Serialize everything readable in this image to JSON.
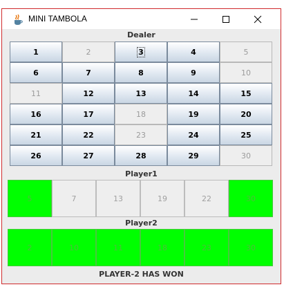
{
  "window": {
    "title": "MINI TAMBOLA",
    "controls": [
      "minimize",
      "maximize",
      "close"
    ],
    "icons": {
      "app": "java-cup-icon",
      "minimize": "minimize-icon",
      "maximize": "maximize-icon",
      "close": "close-icon"
    }
  },
  "dealer": {
    "label": "Dealer",
    "numbers": [
      {
        "value": "1",
        "called": false,
        "focused": false
      },
      {
        "value": "2",
        "called": true,
        "focused": false
      },
      {
        "value": "3",
        "called": false,
        "focused": true
      },
      {
        "value": "4",
        "called": false,
        "focused": false
      },
      {
        "value": "5",
        "called": true,
        "focused": false
      },
      {
        "value": "6",
        "called": false,
        "focused": false
      },
      {
        "value": "7",
        "called": false,
        "focused": false
      },
      {
        "value": "8",
        "called": false,
        "focused": false
      },
      {
        "value": "9",
        "called": false,
        "focused": false
      },
      {
        "value": "10",
        "called": true,
        "focused": false
      },
      {
        "value": "11",
        "called": true,
        "focused": false
      },
      {
        "value": "12",
        "called": false,
        "focused": false
      },
      {
        "value": "13",
        "called": false,
        "focused": false
      },
      {
        "value": "14",
        "called": false,
        "focused": false
      },
      {
        "value": "15",
        "called": false,
        "focused": false
      },
      {
        "value": "16",
        "called": false,
        "focused": false
      },
      {
        "value": "17",
        "called": false,
        "focused": false
      },
      {
        "value": "18",
        "called": true,
        "focused": false
      },
      {
        "value": "19",
        "called": false,
        "focused": false
      },
      {
        "value": "20",
        "called": false,
        "focused": false
      },
      {
        "value": "21",
        "called": false,
        "focused": false
      },
      {
        "value": "22",
        "called": false,
        "focused": false
      },
      {
        "value": "23",
        "called": true,
        "focused": false
      },
      {
        "value": "24",
        "called": false,
        "focused": false
      },
      {
        "value": "25",
        "called": false,
        "focused": false
      },
      {
        "value": "26",
        "called": false,
        "focused": false
      },
      {
        "value": "27",
        "called": false,
        "focused": false
      },
      {
        "value": "28",
        "called": false,
        "focused": false
      },
      {
        "value": "29",
        "called": false,
        "focused": false
      },
      {
        "value": "30",
        "called": true,
        "focused": false
      }
    ]
  },
  "player1": {
    "label": "Player1",
    "cells": [
      {
        "value": "5",
        "marked": true
      },
      {
        "value": "7",
        "marked": false
      },
      {
        "value": "13",
        "marked": false
      },
      {
        "value": "19",
        "marked": false
      },
      {
        "value": "22",
        "marked": false
      },
      {
        "value": "30",
        "marked": true
      }
    ]
  },
  "player2": {
    "label": "Player2",
    "cells": [
      {
        "value": "2",
        "marked": true
      },
      {
        "value": "10",
        "marked": true
      },
      {
        "value": "11",
        "marked": true
      },
      {
        "value": "18",
        "marked": true
      },
      {
        "value": "23",
        "marked": true
      },
      {
        "value": "30",
        "marked": true
      }
    ]
  },
  "status": {
    "message": "PLAYER-2 HAS WON"
  },
  "colors": {
    "marked": "#00ff00",
    "border": "#d0292b"
  }
}
